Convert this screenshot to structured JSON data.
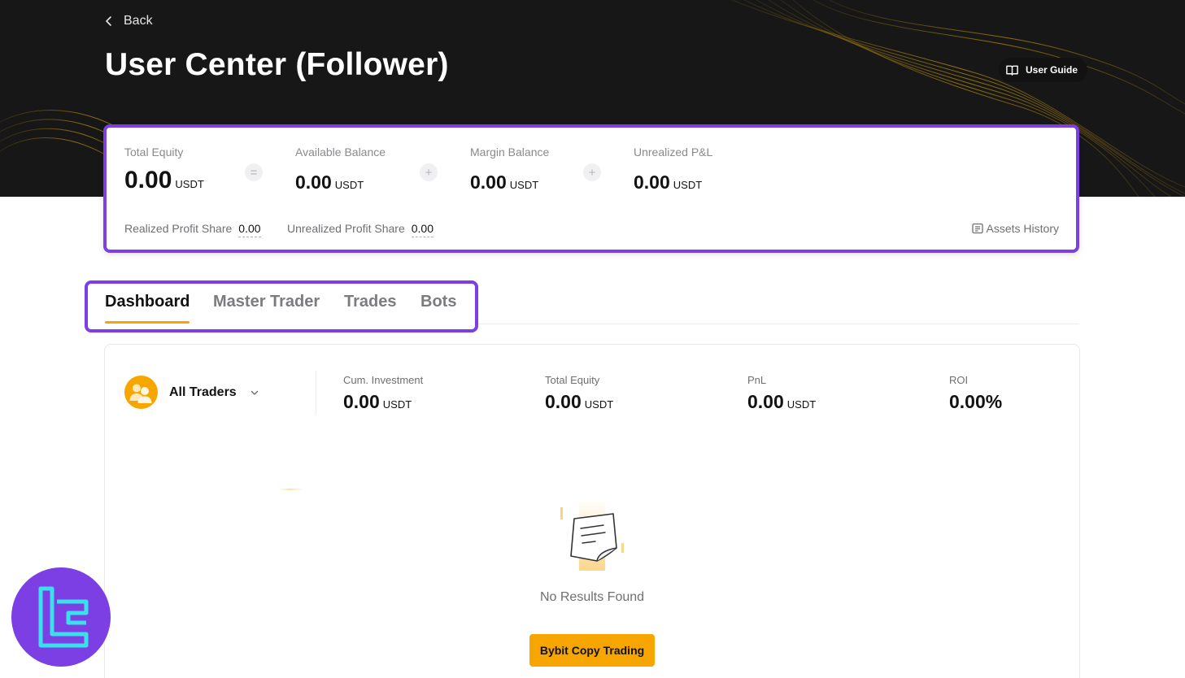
{
  "header": {
    "back_label": "Back",
    "title": "User Center (Follower)",
    "user_guide_label": "User Guide"
  },
  "assets": {
    "total_equity": {
      "label": "Total Equity",
      "value": "0.00",
      "unit": "USDT"
    },
    "available_balance": {
      "label": "Available Balance",
      "value": "0.00",
      "unit": "USDT"
    },
    "margin_balance": {
      "label": "Margin Balance",
      "value": "0.00",
      "unit": "USDT"
    },
    "unrealized_pnl": {
      "label": "Unrealized P&L",
      "value": "0.00",
      "unit": "USDT"
    },
    "op_equals": "=",
    "op_plus_1": "+",
    "op_plus_2": "+",
    "realized_profit_share": {
      "label": "Realized Profit Share",
      "value": "0.00"
    },
    "unrealized_profit_share": {
      "label": "Unrealized Profit Share",
      "value": "0.00"
    },
    "history_label": "Assets History"
  },
  "tabs": [
    {
      "label": "Dashboard",
      "active": true
    },
    {
      "label": "Master Trader",
      "active": false
    },
    {
      "label": "Trades",
      "active": false
    },
    {
      "label": "Bots",
      "active": false
    }
  ],
  "dashboard": {
    "trader_select": "All Traders",
    "metrics": [
      {
        "label": "Cum. Investment",
        "value": "0.00",
        "unit": "USDT"
      },
      {
        "label": "Total Equity",
        "value": "0.00",
        "unit": "USDT"
      },
      {
        "label": "PnL",
        "value": "0.00",
        "unit": "USDT"
      },
      {
        "label": "ROI",
        "value": "0.00%",
        "unit": ""
      }
    ],
    "empty_text": "No Results Found",
    "cta_label": "Bybit Copy Trading"
  },
  "colors": {
    "accent": "#f7a600",
    "highlight_border": "#7b3fe4",
    "hero_bg": "#171717"
  }
}
